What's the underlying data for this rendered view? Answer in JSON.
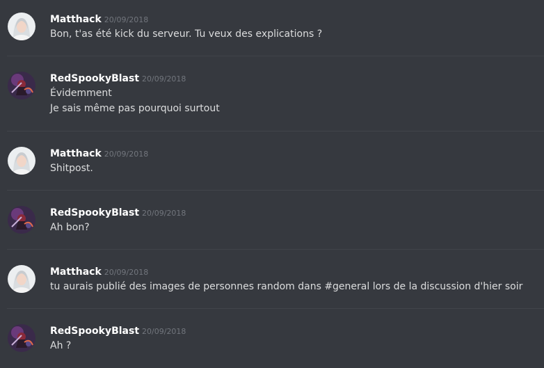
{
  "messages": [
    {
      "author": "Matthack",
      "timestamp": "20/09/2018",
      "avatar": "matthack-avatar",
      "lines": [
        "Bon, t'as été kick du serveur. Tu veux des explications ?"
      ]
    },
    {
      "author": "RedSpookyBlast",
      "timestamp": "20/09/2018",
      "avatar": "redspookyblast-avatar",
      "lines": [
        "Évidemment",
        "Je sais même pas pourquoi surtout"
      ]
    },
    {
      "author": "Matthack",
      "timestamp": "20/09/2018",
      "avatar": "matthack-avatar",
      "lines": [
        "Shitpost."
      ]
    },
    {
      "author": "RedSpookyBlast",
      "timestamp": "20/09/2018",
      "avatar": "redspookyblast-avatar",
      "lines": [
        "Ah bon?"
      ]
    },
    {
      "author": "Matthack",
      "timestamp": "20/09/2018",
      "avatar": "matthack-avatar",
      "lines": [
        "tu aurais publié des images de personnes random dans #general lors de la discussion d'hier soir"
      ]
    },
    {
      "author": "RedSpookyBlast",
      "timestamp": "20/09/2018",
      "avatar": "redspookyblast-avatar",
      "lines": [
        "Ah ?"
      ]
    }
  ],
  "colors": {
    "background": "#36393f",
    "username": "#ffffff",
    "timestamp": "#72767d",
    "message_text": "#dcddde",
    "divider": "#41444a"
  }
}
